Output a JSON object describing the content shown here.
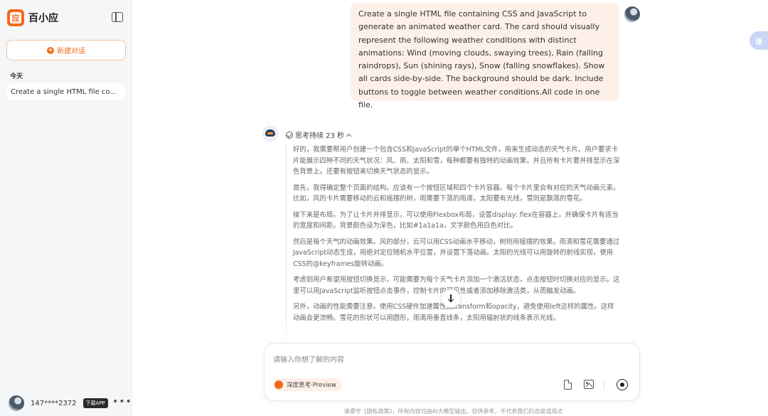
{
  "sidebar": {
    "brand_logo_glyph": "应",
    "brand_name": "百小应",
    "new_chat_label": "新建对话",
    "section_today": "今天",
    "history": [
      {
        "title": "Create a single HTML file co..."
      }
    ],
    "user": {
      "name": "147****2372",
      "download_label": "下载APP",
      "more": "•••"
    }
  },
  "translate_label": "译",
  "user_message": "Create a single HTML file containing CSS and JavaScript to generate an animated weather card. The card should visually represent the following weather conditions with distinct animations: Wind (moving clouds, swaying trees), Rain (falling raindrops), Sun (shining rays), Snow (falling snowflakes). Show all cards side-by-side. The background should be dark. Include buttons to toggle between weather conditions.All code in one file.",
  "bot": {
    "thinking_label": "思考持续 23 秒",
    "thinking": [
      "好的，我需要帮用户创建一个包含CSS和JavaScript的单个HTML文件，用来生成动态的天气卡片。用户要求卡片能展示四种不同的天气状况：风、雨、太阳和雪，每种都要有独特的动画效果，并且所有卡片要并排显示在深色背景上。还要有按钮来切换天气状态的显示。",
      "首先，我得确定整个页面的结构。应该有一个按钮区域和四个卡片容器。每个卡片里会有对应的天气动画元素。比如，风的卡片需要移动的云和摇摆的树，雨需要下落的雨滴，太阳要有光线，雪则是飘落的雪花。",
      "接下来是布局。为了让卡片并排显示，可以使用Flexbox布局，设置display: flex在容器上，并确保卡片有适当的宽度和间距。背景颜色设为深色，比如#1a1a1a，文字颜色用白色对比。",
      "然后是每个天气的动画效果。风的部分，云可以用CSS动画水平移动，树则用摇摆的效果。雨滴和雪花需要通过JavaScript动态生成，用绝对定位随机水平位置，并设置下落动画。太阳的光线可以用旋转的射线实现，使用CSS的@keyframes旋转动画。",
      "考虑到用户希望用按钮切换显示，可能需要为每个天气卡片添加一个激活状态，点击按钮时切换对应的显示。这里可以用JavaScript监听按钮点击事件，控制卡片的可见性或者添加移除激活类，从而触发动画。",
      "另外，动画的性能需要注意。使用CSS硬件加速属性如transform和opacity，避免使用left这样的属性。这样动画会更流畅。雪花的形状可以用圆形，雨滴用垂直线条，太阳用辐射状的线条表示光线。"
    ]
  },
  "input": {
    "placeholder": "请输入你想了解的内容",
    "deep_think_label": "深度思考·Preview"
  },
  "footer_text": "请遵守《隐私政策》，所有内容均由AI大模型输出，仅供参考，不代表我们的态度或观点"
}
